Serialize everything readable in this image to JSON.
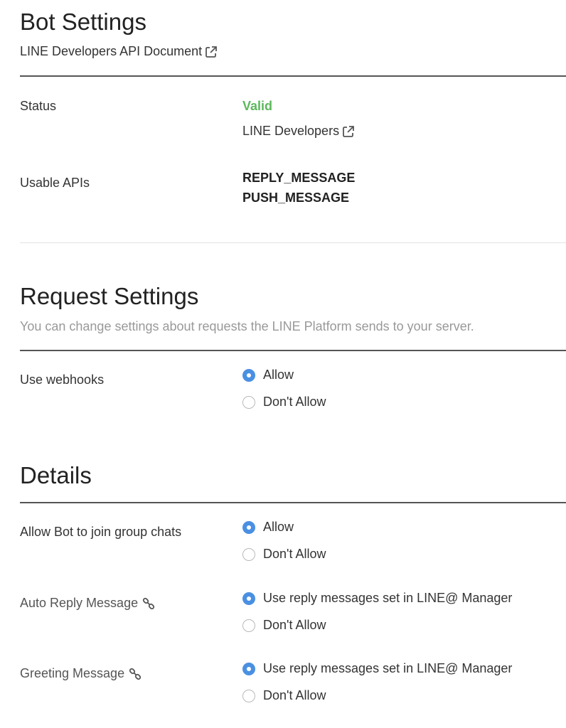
{
  "bot_settings": {
    "title": "Bot Settings",
    "doc_link": "LINE Developers API Document",
    "status_label": "Status",
    "status_value": "Valid",
    "status_link": "LINE Developers",
    "apis_label": "Usable APIs",
    "apis": [
      "REPLY_MESSAGE",
      "PUSH_MESSAGE"
    ]
  },
  "request_settings": {
    "title": "Request Settings",
    "description": "You can change settings about requests the LINE Platform sends to your server.",
    "webhooks_label": "Use webhooks",
    "webhooks_options": [
      "Allow",
      "Don't Allow"
    ],
    "webhooks_selected": "Allow"
  },
  "details": {
    "title": "Details",
    "group_label": "Allow Bot to join group chats",
    "group_options": [
      "Allow",
      "Don't Allow"
    ],
    "group_selected": "Allow",
    "auto_reply_label": "Auto Reply Message",
    "auto_reply_options": [
      "Use reply messages set in LINE@ Manager",
      "Don't Allow"
    ],
    "auto_reply_selected": "Use reply messages set in LINE@ Manager",
    "greeting_label": "Greeting Message",
    "greeting_options": [
      "Use reply messages set in LINE@ Manager",
      "Don't Allow"
    ],
    "greeting_selected": "Use reply messages set in LINE@ Manager"
  },
  "colors": {
    "valid": "#5cb85c",
    "radio_selected": "#4a90e2",
    "rule": "#555555",
    "muted_text": "#999999"
  },
  "icons": {
    "external_link": "external-link-icon",
    "chain_link": "chain-link-icon"
  }
}
